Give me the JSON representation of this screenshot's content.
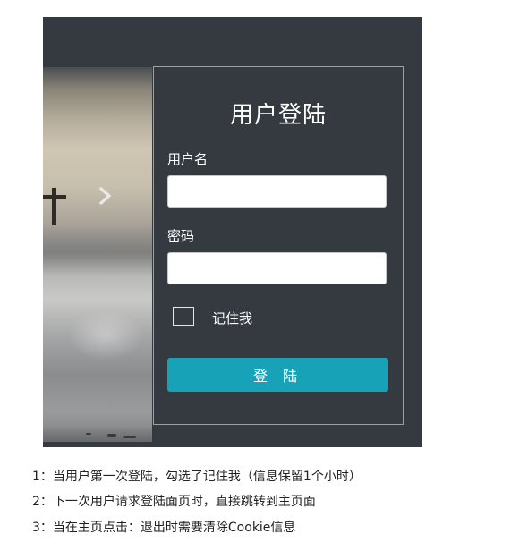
{
  "login": {
    "title": "用户登陆",
    "username_label": "用户名",
    "username_value": "",
    "password_label": "密码",
    "password_value": "",
    "remember_label": "记住我",
    "remember_checked": false,
    "submit_label": "登 陆"
  },
  "carousel": {
    "next_icon": "chevron-right-icon"
  },
  "colors": {
    "page_bg": "#343a40",
    "button_bg": "#17a2b8",
    "panel_border": "#9aa0a4"
  },
  "notes": [
    "1：当用户第一次登陆，勾选了记住我（信息保留1个小时）",
    "2：下一次用户请求登陆面页时，直接跳转到主页面",
    "3：当在主页点击：退出时需要清除Cookie信息"
  ]
}
